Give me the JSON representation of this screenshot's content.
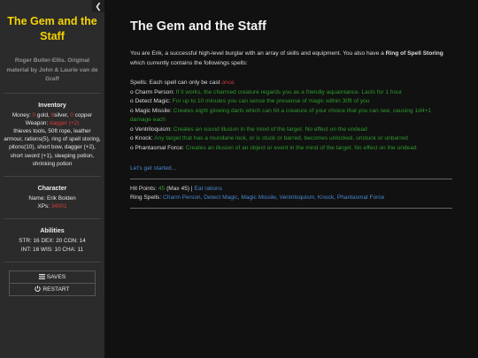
{
  "sidebar": {
    "collapse_glyph": "❮",
    "title": "The Gem and the Staff",
    "byline": "Roger Butler-Ellis. Original material by John & Laurie van de Graff",
    "inventory": {
      "heading": "Inventory",
      "money_label": "Money:",
      "gold_count": "0",
      "gold_label": " gold, ",
      "silver_count": "8",
      "silver_label": "silver, ",
      "copper_count": "0",
      "copper_label": " copper",
      "weapon_label": "Weapon: ",
      "weapon_value": "dagger (+2)",
      "items": "thieves tools, 50ft rope, leather armour, rations(5), ring of spell storing, pitons(10), short bow, dagger (+2), short sword (+1), sleeping potion, shrinking potion"
    },
    "character": {
      "heading": "Character",
      "name_label": "Name: ",
      "name_value": "Erik Bolden",
      "xps_label": "XPs: ",
      "xps_value": "34001"
    },
    "abilities": {
      "heading": "Abilities",
      "line1": "STR: 16 DEX: 20 CON: 14",
      "line2": "INT: 16 WIS: 10 CHA: 11"
    },
    "buttons": {
      "saves": "SAVES",
      "restart": "RESTART"
    }
  },
  "main": {
    "title": "The Gem and the Staff",
    "intro_a": "You are Erik, a successful high-level burglar with an array of skills and equipment. You also have a ",
    "intro_ring": "Ring of Spell Storing",
    "intro_b": " which currently contains the followings spells:",
    "spells_note_a": "Spells: Each spell can only be cast ",
    "spells_note_once": "once",
    "spells": [
      {
        "name": "o Charm Person: ",
        "desc": "If it works, the charmed creature regards you as a friendly aquaintance. Lasts for 1 hour"
      },
      {
        "name": "o Detect Magic: ",
        "desc": "For up to 10 minutes you can sense the presense of magic within 30ft of you"
      },
      {
        "name": "o Magic Missile: ",
        "desc": "Creates eight glowing darts which can hit a creature of your choice that you can see, causing 1d4+1 damage each"
      },
      {
        "name": "o Ventriloquism: ",
        "desc": "Creates an sound illusion in the mind of the target. No effect on the undead"
      },
      {
        "name": "o Knock: ",
        "desc": "Any target that has a mundane lock, or is stuck or barred, becomes unlocked, unstuck or unbarred"
      },
      {
        "name": "o Phantasmal Force: ",
        "desc": "Creates an illusion of an object or event in the mind of the target. No effect on the undead"
      }
    ],
    "start_link": "Let's get started...",
    "hp_label": "Hit Points: ",
    "hp_value": "45",
    "hp_max": " (Max 45) | ",
    "eat_link": "Eat rations",
    "ring_label": "Ring Spells: ",
    "ring_spells": "Charm Person, Detect Magic, Magic Missile, Ventriloquism, Knock, Phantasmal Force"
  }
}
